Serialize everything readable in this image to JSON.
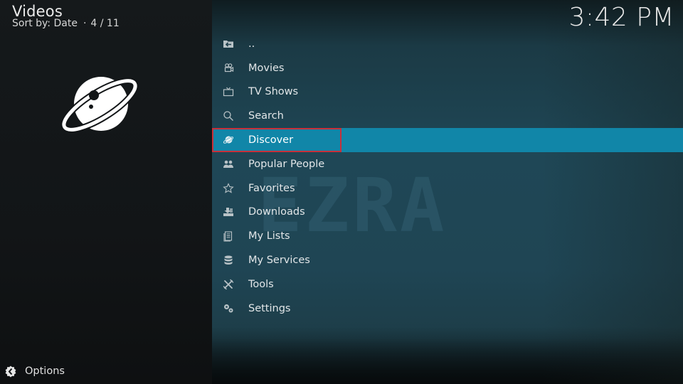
{
  "header": {
    "title": "Videos",
    "sort_label": "Sort by: Date",
    "separator": "·",
    "position": "4 / 11"
  },
  "clock": "3:42 PM",
  "thumbnail": {
    "icon": "planet-icon"
  },
  "watermark": "EZRA",
  "menu": {
    "selected_index": 4,
    "items": [
      {
        "label": "..",
        "icon": "folder-back-icon"
      },
      {
        "label": "Movies",
        "icon": "film-camera-icon"
      },
      {
        "label": "TV Shows",
        "icon": "tv-icon"
      },
      {
        "label": "Search",
        "icon": "search-icon"
      },
      {
        "label": "Discover",
        "icon": "planet-icon"
      },
      {
        "label": "Popular People",
        "icon": "people-icon"
      },
      {
        "label": "Favorites",
        "icon": "star-icon"
      },
      {
        "label": "Downloads",
        "icon": "download-icon"
      },
      {
        "label": "My Lists",
        "icon": "list-icon"
      },
      {
        "label": "My Services",
        "icon": "database-icon"
      },
      {
        "label": "Tools",
        "icon": "tools-icon"
      },
      {
        "label": "Settings",
        "icon": "gears-icon"
      }
    ]
  },
  "footer": {
    "options_label": "Options",
    "options_icon": "options-icon"
  },
  "colors": {
    "selected_bg": "#1186a8",
    "focus_border": "#c8303a",
    "panel_bg": "#1f4554",
    "left_bg": "#141819"
  }
}
